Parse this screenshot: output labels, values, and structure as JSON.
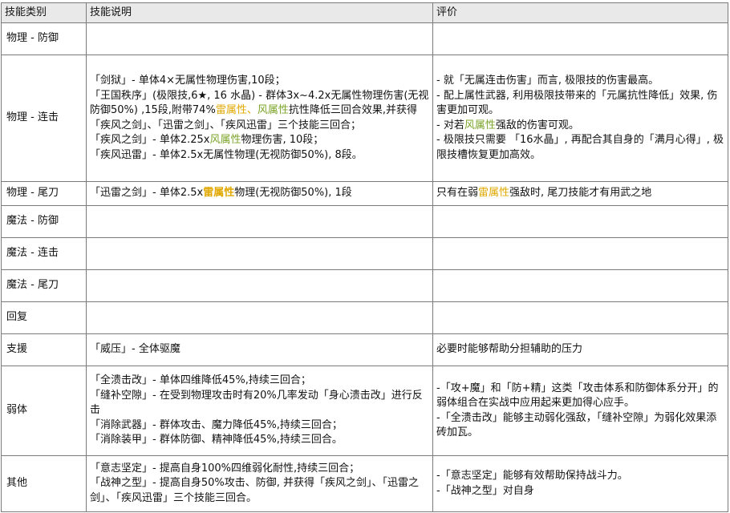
{
  "headers": {
    "category": "技能类别",
    "description": "技能说明",
    "evaluation": "评价"
  },
  "rows": [
    {
      "category": "物理 - 防御"
    },
    {
      "category": "物理 - 连击",
      "desc": {
        "l1": "「剑狱」- 单体4×无属性物理伤害,10段；",
        "l2a": "「王国秩序」(极限技,6★, 16 水晶) - 群体3x~4.2x无属性物理伤害(无视防御50%) ,15段,附带74%",
        "l2b": "雷属性",
        "l2c": "、",
        "l2d": "风属性",
        "l2e": "抗性降低三回合效果,并获得「疾风之剑」、「迅雷之剑」、「疾风迅雷」三个技能三回合；",
        "l3a": "「疾风之剑」- 单体2.25x",
        "l3b": "风属性",
        "l3c": "物理伤害, 10段；",
        "l4": "「疾风迅雷」- 单体2.5x无属性物理(无视防御50%), 8段。"
      },
      "eval": {
        "e1": "- 就「无属连击伤害」而言, 极限技的伤害最高。",
        "e2": "- 配上属性武器, 利用极限技带来的「元属抗性降低」效果, 伤害更加可观。",
        "e3a": "- 对若",
        "e3b": "风属性",
        "e3c": "强敌的伤害可观。",
        "e4": "- 极限技只需要 「16水晶」, 再配合其自身的「满月心得」, 极限技槽恢复更加高效。"
      }
    },
    {
      "category": "物理 - 尾刀",
      "desc": {
        "a": "「迅雷之剑」- 单体2.5x",
        "b": "雷属性",
        "c": "物理(无视防御50%), 1段"
      },
      "eval": {
        "a": "只有在弱",
        "b": "雷属性",
        "c": "强敌时, 尾刀技能才有用武之地"
      }
    },
    {
      "category": "魔法 - 防御"
    },
    {
      "category": "魔法 - 连击"
    },
    {
      "category": "魔法 - 尾刀"
    },
    {
      "category": "回复"
    },
    {
      "category": "支援",
      "desc": "「威压」- 全体驱魔",
      "eval": "必要时能够帮助分担辅助的压力"
    },
    {
      "category": "弱体",
      "desc": {
        "l1": "「全溃击改」- 单体四维降低45%,持续三回合；",
        "l2": "「缝补空隙」- 在受到物理攻击时有20%几率发动「身心溃击改」进行反击",
        "l3": "「消除武器」- 群体攻击、魔力降低45%,持续三回合；",
        "l4": "「消除装甲」- 群体防御、精神降低45%,持续三回合。"
      },
      "eval": {
        "e1": "-「攻+魔」和「防+精」这类「攻击体系和防御体系分开」的弱体组合在实战中应用起来更加得心应手。",
        "e2": "-「全溃击改」能够主动弱化强敌，「缝补空隙」为弱化效果添砖加瓦。"
      }
    },
    {
      "category": "其他",
      "desc": {
        "l1": "「意志坚定」- 提高自身100%四维弱化耐性,持续三回合；",
        "l2": "「战神之型」- 提高自身50%攻击、防御, 并获得「疾风之剑」、「迅雷之剑」、「疾风迅雷」三个技能三回合。"
      },
      "eval": {
        "e1": "-「意志坚定」能够有效帮助保持战斗力。",
        "e2": "-「战神之型」对自身"
      }
    }
  ],
  "colors": {
    "thunder": "#e0a800",
    "wind": "#7ba428",
    "header_bg": "#e9e9e9",
    "border": "#7a7a7a"
  }
}
